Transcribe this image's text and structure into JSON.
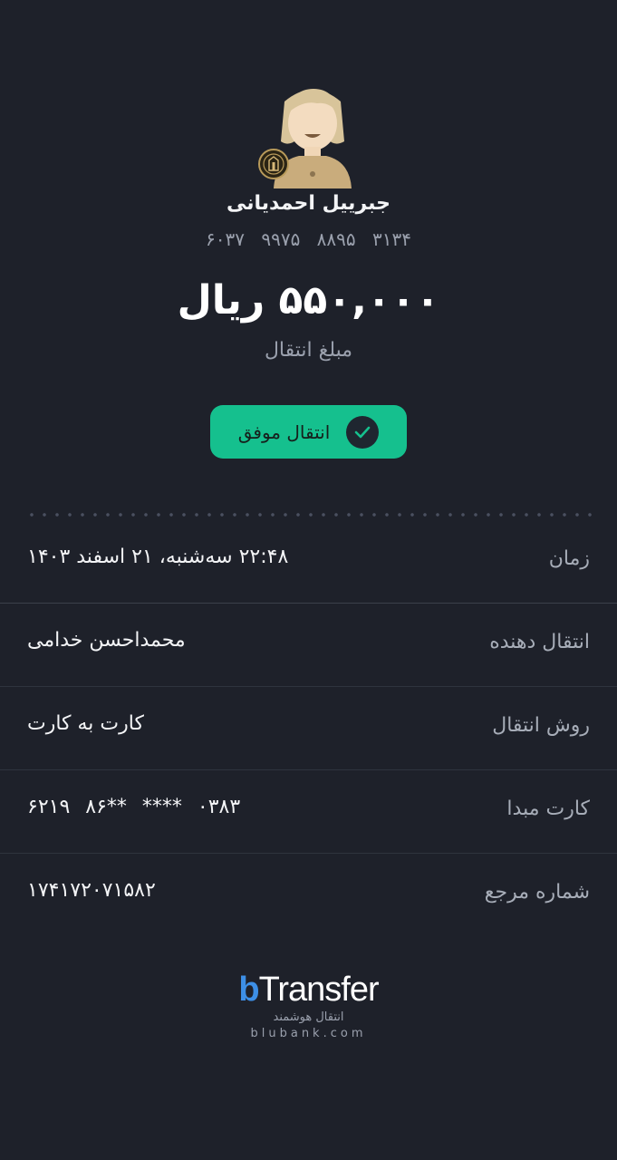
{
  "recipient": {
    "name": "جبرییل احمدیانی",
    "card_number": "۶۰۳۷ ۹۹۷۵ ۸۸۹۵ ۳۱۳۴",
    "avatar_icon": "user-avatar-icon",
    "bank_logo_icon": "bank-melli-logo-icon"
  },
  "transfer": {
    "amount": "۵۵۰,۰۰۰ ریال",
    "amount_label": "مبلغ انتقال",
    "status_text": "انتقال موفق",
    "status_color": "#15c08e"
  },
  "details": [
    {
      "label": "زمان",
      "value": "۲۲:۴۸ سه‌شنبه، ۲۱ اسفند ۱۴۰۳"
    },
    {
      "label": "انتقال دهنده",
      "value": "محمداحسن خدامی"
    },
    {
      "label": "روش انتقال",
      "value": "کارت به کارت"
    },
    {
      "label": "کارت مبدا",
      "value": "۶۲۱۹ ۸۶** **** ۰۳۸۳"
    },
    {
      "label": "شماره مرجع",
      "value": "۱۷۴۱۷۲۰۷۱۵۸۲"
    }
  ],
  "brand": {
    "logo_b": "b",
    "logo_rest": "Transfer",
    "tagline": "انتقال هوشمند",
    "url": "blubank.com"
  }
}
